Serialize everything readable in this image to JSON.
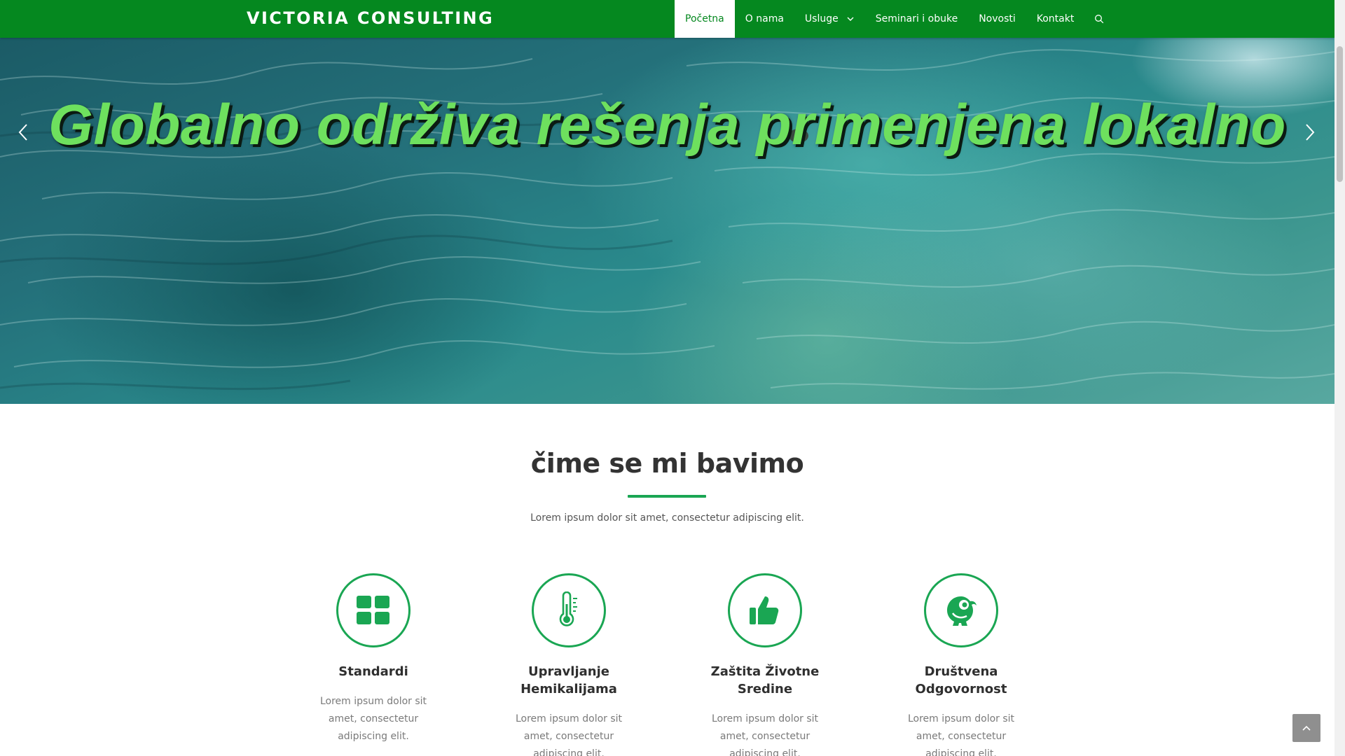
{
  "brand": {
    "name": "VICTORIA CONSULTING"
  },
  "nav": {
    "items": [
      {
        "label": "Početna",
        "active": true
      },
      {
        "label": "O nama"
      },
      {
        "label": "Usluge",
        "has_dropdown": true
      },
      {
        "label": "Seminari i obuke"
      },
      {
        "label": "Novosti"
      },
      {
        "label": "Kontakt"
      }
    ],
    "search_icon": "search-icon"
  },
  "hero": {
    "title": "Globalno održiva rešenja primenjena lokalno",
    "prev_icon": "chevron-left-icon",
    "next_icon": "chevron-right-icon"
  },
  "section": {
    "title": "čime se mi bavimo",
    "subtitle": "Lorem ipsum dolor sit amet, consectetur adipiscing elit."
  },
  "features": [
    {
      "icon": "grid-icon",
      "title": "Standardi",
      "text": "Lorem ipsum dolor sit amet, consectetur adipiscing elit."
    },
    {
      "icon": "thermometer-icon",
      "title": "Upravljanje Hemikalijama",
      "text": "Lorem ipsum dolor sit amet, consectetur adipiscing elit."
    },
    {
      "icon": "thumbs-up-icon",
      "title": "Zaštita Životne Sredine",
      "text": "Lorem ipsum dolor sit amet, consectetur adipiscing elit."
    },
    {
      "icon": "bird-icon",
      "title": "Društvena Odgovornost",
      "text": "Lorem ipsum dolor sit amet, consectetur adipiscing elit."
    }
  ],
  "colors": {
    "navbar": "#05881f",
    "accent": "#1aa653",
    "hero_title": "#6ee05e"
  },
  "back_to_top_icon": "chevron-up-icon"
}
